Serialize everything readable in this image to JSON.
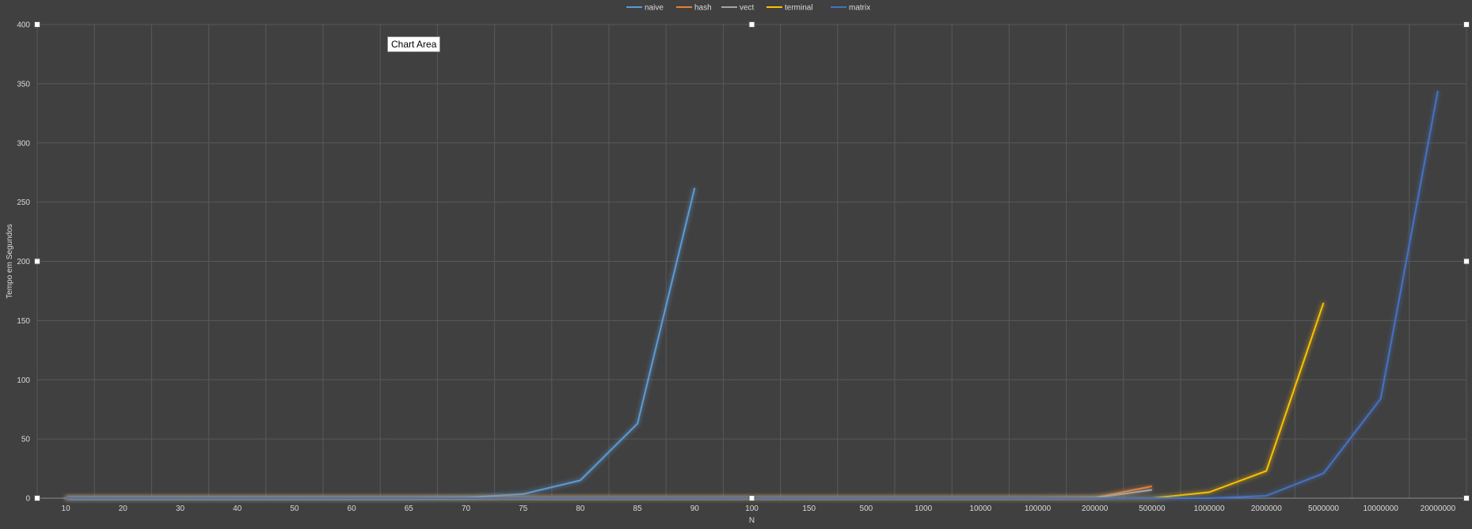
{
  "tooltip": "Chart Area",
  "chart_data": {
    "type": "line",
    "xlabel": "N",
    "ylabel": "Tempo em Segundos",
    "ylim": [
      0,
      400
    ],
    "yticks": [
      0,
      50,
      100,
      150,
      200,
      250,
      300,
      350,
      400
    ],
    "grid": true,
    "legend_position": "top",
    "categories": [
      "10",
      "20",
      "30",
      "40",
      "50",
      "60",
      "65",
      "70",
      "75",
      "80",
      "85",
      "90",
      "100",
      "150",
      "500",
      "1000",
      "10000",
      "100000",
      "200000",
      "500000",
      "1000000",
      "2000000",
      "5000000",
      "10000000",
      "20000000"
    ],
    "series": [
      {
        "name": "naive",
        "color": "#5b9bd5",
        "values": [
          0,
          0,
          0,
          0,
          0,
          0,
          0,
          0.5,
          3.5,
          15,
          63,
          262,
          null,
          null,
          null,
          null,
          null,
          null,
          null,
          null,
          null,
          null,
          null,
          null,
          null
        ]
      },
      {
        "name": "hash",
        "color": "#ed7d31",
        "values": [
          0,
          0,
          0,
          0,
          0,
          0,
          0,
          0,
          0,
          0,
          0,
          0,
          0,
          0,
          0,
          0,
          0,
          0,
          0.5,
          10,
          null,
          null,
          null,
          null,
          null
        ]
      },
      {
        "name": "vect",
        "color": "#a5a5a5",
        "values": [
          0,
          0,
          0,
          0,
          0,
          0,
          0,
          0,
          0,
          0,
          0,
          0,
          0,
          0,
          0,
          0,
          0,
          0,
          0.3,
          7,
          null,
          null,
          null,
          null,
          null
        ]
      },
      {
        "name": "terminal",
        "color": "#ffc000",
        "values": [
          0,
          0,
          0,
          0,
          0,
          0,
          0,
          0,
          0,
          0,
          0,
          0,
          0,
          0,
          0,
          0,
          0,
          0,
          0,
          0,
          5,
          23,
          165,
          null,
          null
        ]
      },
      {
        "name": "matrix",
        "color": "#4472c4",
        "values": [
          0,
          0,
          0,
          0,
          0,
          0,
          0,
          0,
          0,
          0,
          0,
          0,
          0,
          0,
          0,
          0,
          0,
          0,
          0,
          0,
          0,
          2,
          21,
          84,
          344
        ]
      }
    ]
  }
}
